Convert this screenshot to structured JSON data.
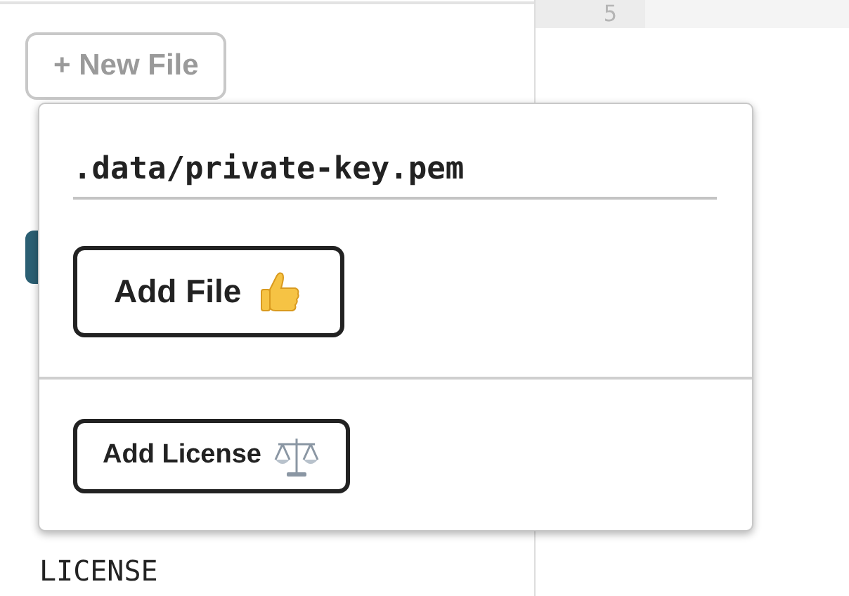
{
  "editor": {
    "line_number": "5"
  },
  "new_file_button": {
    "label": "+ New File"
  },
  "popover": {
    "filename": {
      "value": ".data/private-key.pem"
    },
    "add_file_button": {
      "label": "Add File"
    },
    "add_license_button": {
      "label": "Add License"
    }
  },
  "files": [
    {
      "name": "LICENSE"
    }
  ]
}
